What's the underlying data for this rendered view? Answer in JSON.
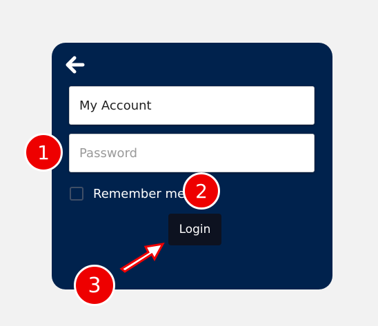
{
  "login_form": {
    "username_value": "My Account",
    "password_placeholder": "Password",
    "remember_label": "Remember me",
    "login_label": "Login"
  },
  "annotations": {
    "badge_1": "1",
    "badge_2": "2",
    "badge_3": "3"
  },
  "icons": {
    "back": "back-arrow-icon",
    "pointer": "pointer-arrow-icon"
  },
  "colors": {
    "panel": "#00224d",
    "page_background": "#f2f2f2",
    "login_button": "#0d1220",
    "badge": "#ee0000"
  }
}
